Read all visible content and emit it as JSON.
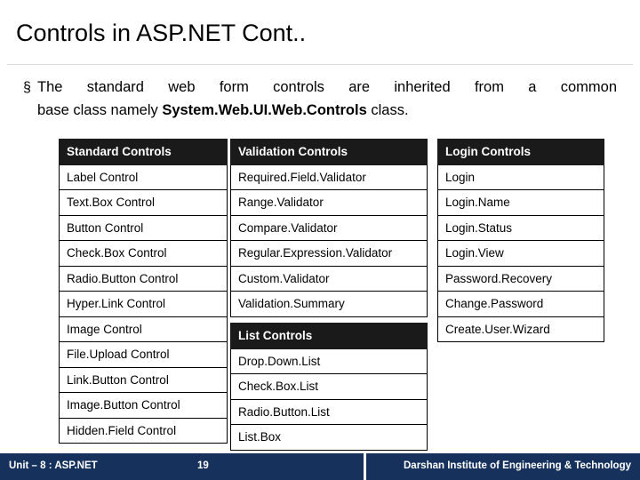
{
  "slide": {
    "title": "Controls in ASP.NET Cont..",
    "bullet_marker": "§",
    "bullet_line1": "The standard web form controls are inherited from a common",
    "bullet_line2_pre": "base class namely ",
    "bullet_line2_bold": "System.Web.UI.Web.Controls",
    "bullet_line2_post": " class."
  },
  "tables": [
    {
      "id": "standard",
      "header": "Standard Controls",
      "rows": [
        "Label Control",
        "Text.Box Control",
        "Button Control",
        "Check.Box Control",
        "Radio.Button Control",
        "Hyper.Link Control",
        "Image Control",
        "File.Upload Control",
        "Link.Button Control",
        "Image.Button Control",
        "Hidden.Field Control"
      ]
    },
    {
      "id": "validation",
      "header": "Validation Controls",
      "rows": [
        "Required.Field.Validator",
        "Range.Validator",
        "Compare.Validator",
        "Regular.Expression.Validator",
        "Custom.Validator",
        "Validation.Summary"
      ]
    },
    {
      "id": "login",
      "header": "Login Controls",
      "rows": [
        "Login",
        "Login.Name",
        "Login.Status",
        "Login.View",
        "Password.Recovery",
        "Change.Password",
        "Create.User.Wizard"
      ]
    },
    {
      "id": "list",
      "header": "List Controls",
      "rows": [
        "Drop.Down.List",
        "Check.Box.List",
        "Radio.Button.List",
        "List.Box"
      ]
    }
  ],
  "footer": {
    "unit": "Unit – 8 : ASP.NET",
    "page": "19",
    "org": "Darshan Institute of Engineering & Technology"
  },
  "colors": {
    "header_bg": "#1a1a1a",
    "footer_bg": "#16325c",
    "text": "#000000"
  }
}
